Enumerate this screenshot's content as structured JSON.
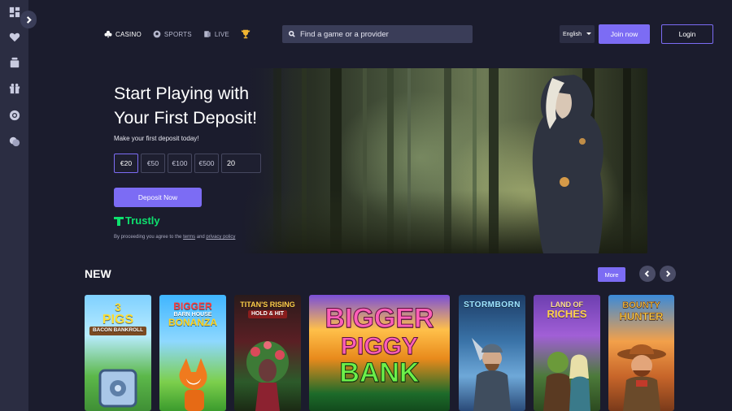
{
  "nav": {
    "items": [
      {
        "label": "CASINO",
        "icon": "clubs-icon",
        "active": true
      },
      {
        "label": "SPORTS",
        "icon": "soccer-ball-icon",
        "active": false
      },
      {
        "label": "LIVE",
        "icon": "live-cards-icon",
        "active": false
      }
    ],
    "trophy_icon": "trophy-icon"
  },
  "search": {
    "placeholder": "Find a game or a provider"
  },
  "language": {
    "selected": "English"
  },
  "auth": {
    "join_label": "Join now",
    "login_label": "Login"
  },
  "sidebar": {
    "icons": [
      "dashboard-icon",
      "heart-icon",
      "gift-box-icon",
      "present-icon",
      "chip-icon",
      "coins-icon"
    ]
  },
  "hero": {
    "title": "Start Playing with Your First Deposit!",
    "subtitle": "Make your first deposit today!",
    "amounts": [
      "€20",
      "€50",
      "€100",
      "€500"
    ],
    "amount_value": "20",
    "deposit_label": "Deposit Now",
    "payment_brand": "Trustly",
    "legal_prefix": "By proceeding you agree to the ",
    "legal_terms": "terms",
    "legal_and": " and ",
    "legal_privacy": "privacy policy"
  },
  "new_section": {
    "title": "NEW",
    "more_label": "More",
    "games": [
      {
        "name": "3 PIGS BACON BANKROLL",
        "line1": "3",
        "line2": "PIGS",
        "line3": "BACON BANKROLL"
      },
      {
        "name": "BIGGER BARN HOUSE BONANZA",
        "line1": "BIGGER",
        "line2": "BARN HOUSE",
        "line3": "BONANZA"
      },
      {
        "name": "TITAN'S RISING HOLD & HIT",
        "line1": "TITAN'S RISING",
        "line2": "HOLD & HIT",
        "line3": ""
      },
      {
        "name": "BIGGER PIGGY BANK",
        "line1": "BIGGER",
        "line2": "PIGGY",
        "line3": "BANK"
      },
      {
        "name": "STORMBORN",
        "line1": "STORMBORN",
        "line2": "",
        "line3": ""
      },
      {
        "name": "LAND OF RICHES",
        "line1": "LAND OF",
        "line2": "RICHES",
        "line3": ""
      },
      {
        "name": "BOUNTY HUNTER",
        "line1": "BOUNTY",
        "line2": "HUNTER",
        "line3": ""
      }
    ]
  },
  "colors": {
    "accent": "#7c6cf4",
    "background": "#1b1c2d",
    "sidebar": "#2b2d42",
    "trustly": "#0ee06e"
  }
}
